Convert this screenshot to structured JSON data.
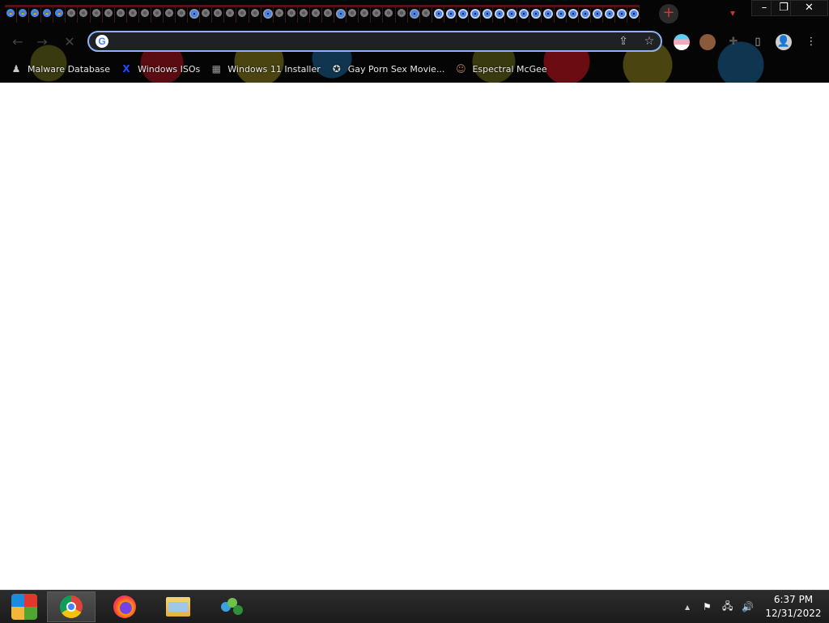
{
  "browser": {
    "address_bar": {
      "value": "",
      "placeholder": ""
    },
    "tab_count_visible": 52,
    "new_tab_symbol": "+",
    "window_controls": {
      "minimize": "–",
      "maximize": "❐",
      "close": "✕"
    },
    "omnibox_icons": {
      "share": "⇪",
      "bookmark": "☆"
    },
    "toolbar_icons": {
      "back": "←",
      "forward": "→",
      "reload": "✕",
      "extensions": "✚",
      "side_panel": "▯",
      "menu": "⋮",
      "profile": "👤"
    }
  },
  "bookmarks": [
    {
      "label": "Malware Database",
      "icon": "person-icon",
      "icon_glyph": "♟",
      "icon_color": "#c8c8c8"
    },
    {
      "label": "Windows ISOs",
      "icon": "x-logo-icon",
      "icon_glyph": "X",
      "icon_color": "#1e4dff"
    },
    {
      "label": "Windows 11 Installer",
      "icon": "image-icon",
      "icon_glyph": "▦",
      "icon_color": "#9a9a9a"
    },
    {
      "label": "Gay Porn Sex Movie...",
      "icon": "site-icon",
      "icon_glyph": "✪",
      "icon_color": "#cfcfcf"
    },
    {
      "label": "Espectral McGee",
      "icon": "avatar-icon",
      "icon_glyph": "☺",
      "icon_color": "#b08060"
    }
  ],
  "taskbar": {
    "apps": [
      {
        "name": "start-button",
        "active": false
      },
      {
        "name": "chrome",
        "active": true
      },
      {
        "name": "firefox",
        "active": false
      },
      {
        "name": "file-explorer",
        "active": false
      },
      {
        "name": "network-app",
        "active": false
      }
    ],
    "tray": {
      "show_hidden": "▲",
      "flag": "⚑",
      "network": "🖧",
      "volume": "🔊"
    },
    "clock": {
      "time": "6:37 PM",
      "date": "12/31/2022"
    }
  },
  "colors": {
    "accent": "#8ab4f8",
    "chrome_bg": "#050505",
    "taskbar_bg": "#222222"
  }
}
